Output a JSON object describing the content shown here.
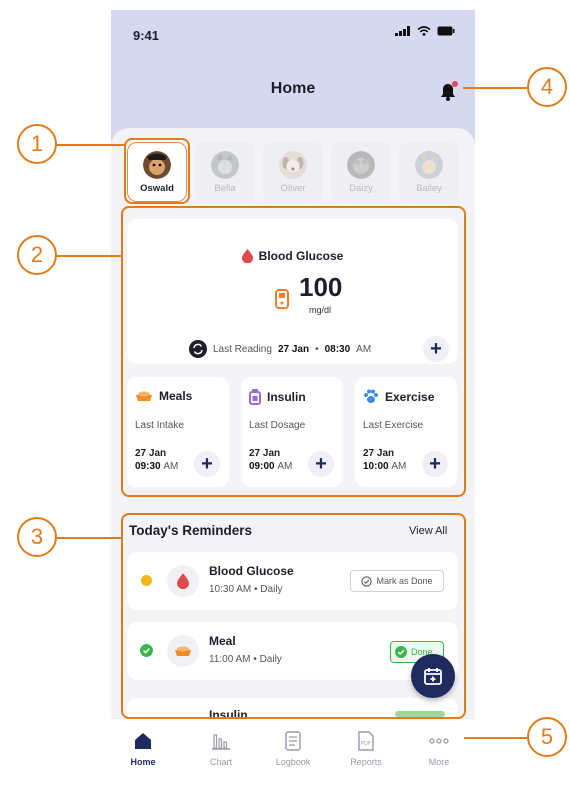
{
  "status_bar": {
    "time": "9:41"
  },
  "header": {
    "title": "Home"
  },
  "pets": [
    {
      "name": "Oswald",
      "active": true,
      "color": "#6b4a32"
    },
    {
      "name": "Bella",
      "active": false,
      "color": "#9aa3a8"
    },
    {
      "name": "Oliver",
      "active": false,
      "color": "#b89a86"
    },
    {
      "name": "Daizy",
      "active": false,
      "color": "#8a8a8a"
    },
    {
      "name": "Bailey",
      "active": false,
      "color": "#a7b5c4"
    }
  ],
  "glucose": {
    "title": "Blood Glucose",
    "value": "100",
    "unit": "mg/dl",
    "last_label": "Last Reading",
    "last_date": "27 Jan",
    "last_time": "08:30",
    "last_ampm": "AM"
  },
  "trackers": [
    {
      "title": "Meals",
      "sub": "Last Intake",
      "date": "27 Jan",
      "time": "09:30",
      "ampm": "AM",
      "icon": "bowl-icon"
    },
    {
      "title": "Insulin",
      "sub": "Last Dosage",
      "date": "27 Jan",
      "time": "09:00",
      "ampm": "AM",
      "icon": "insulin-pen-icon"
    },
    {
      "title": "Exercise",
      "sub": "Last Exercise",
      "date": "27 Jan",
      "time": "10:00",
      "ampm": "AM",
      "icon": "paw-icon"
    }
  ],
  "reminders": {
    "title": "Today's Reminders",
    "view_all": "View All",
    "items": [
      {
        "title": "Blood Glucose",
        "sub": "10:30 AM • Daily",
        "action": "Mark as Done",
        "status": "pending"
      },
      {
        "title": "Meal",
        "sub": "11:00 AM • Daily",
        "action": "Done",
        "status": "done"
      },
      {
        "title": "Insulin",
        "status": "done"
      }
    ]
  },
  "tabs": [
    {
      "label": "Home",
      "active": true
    },
    {
      "label": "Chart"
    },
    {
      "label": "Logbook"
    },
    {
      "label": "Reports"
    },
    {
      "label": "More"
    }
  ],
  "callouts": [
    "1",
    "2",
    "3",
    "4",
    "5"
  ],
  "colors": {
    "accent": "#1f2a5e",
    "header_bg": "#d6d8f0",
    "callout": "#e07d1a",
    "blood": "#e04a4a",
    "success": "#3bb54a",
    "pending": "#f2b61b"
  }
}
